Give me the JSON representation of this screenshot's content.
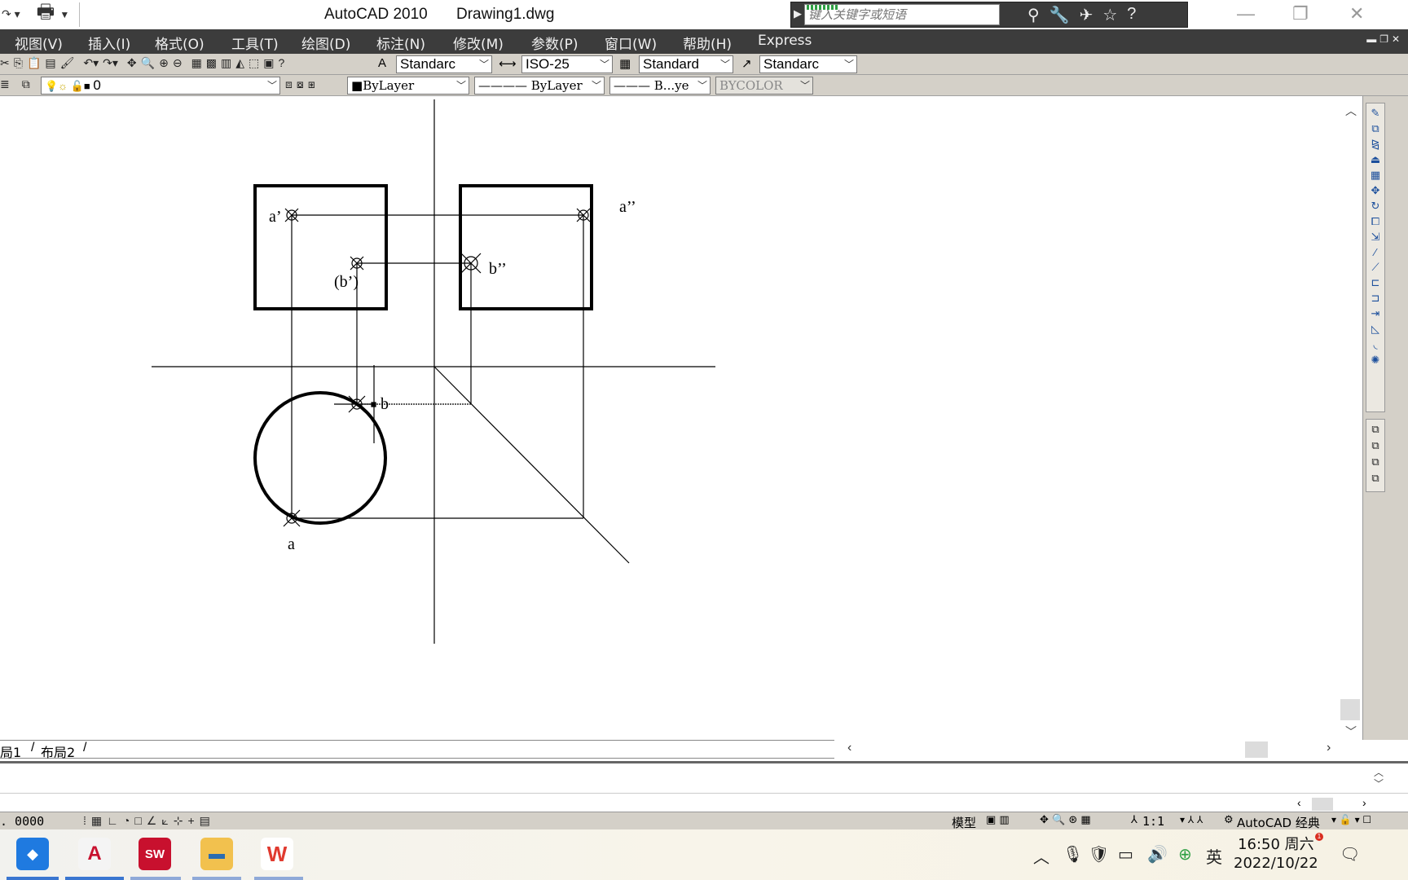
{
  "window": {
    "app_title": "AutoCAD 2010",
    "doc_title": "Drawing1.dwg",
    "search_placeholder": "键入关键字或短语"
  },
  "menu": [
    "视图(V)",
    "插入(I)",
    "格式(O)",
    "工具(T)",
    "绘图(D)",
    "标注(N)",
    "修改(M)",
    "参数(P)",
    "窗口(W)",
    "帮助(H)",
    "Express"
  ],
  "styles": {
    "text_style": "Standarc",
    "dim_style": "ISO-25",
    "table_style": "Standard",
    "multileader_style": "Standarc"
  },
  "layers": {
    "current_layer": "0",
    "color": "ByLayer",
    "linetype": "ByLayer",
    "lineweight": "B...ye",
    "plotstyle": "BYCOLOR"
  },
  "drawing_labels": {
    "a_prime": "a’",
    "a_double_prime": "a’’",
    "b_prime": "(b’)",
    "b_double_prime": "b’’",
    "b": "b",
    "a": "a"
  },
  "layout_tabs": [
    "局1",
    "布局2"
  ],
  "status": {
    "coords": ". 0000",
    "model": "模型",
    "scale": "1:1",
    "workspace": "AutoCAD 经典"
  },
  "taskbar": {
    "ime": "英",
    "time": "16:50 周六",
    "date": "2022/10/22",
    "notification_count": "1"
  }
}
